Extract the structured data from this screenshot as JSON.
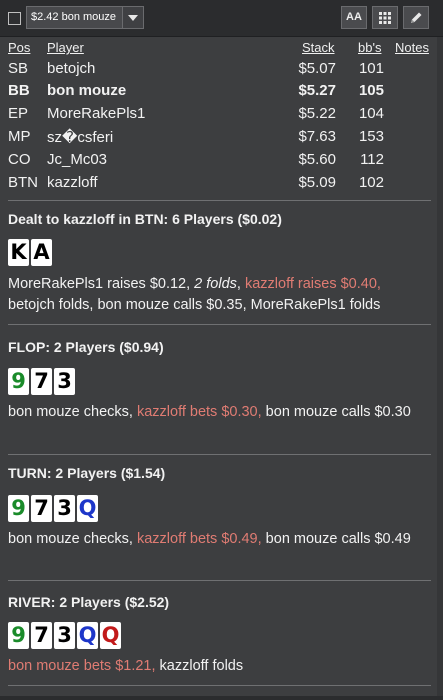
{
  "toolbar": {
    "selected_hand": "$2.42 bon mouze",
    "font_button_label": "AA",
    "grid_icon": "grid-icon",
    "edit_icon": "pencil-icon"
  },
  "table": {
    "headers": {
      "pos": "Pos",
      "player": "Player",
      "stack": "Stack",
      "bbs": "bb's",
      "notes": "Notes"
    },
    "rows": [
      {
        "pos": "SB",
        "player": "betojch",
        "stack": "$5.07",
        "bbs": "101"
      },
      {
        "pos": "BB",
        "player": "bon mouze",
        "stack": "$5.27",
        "bbs": "105",
        "hero": true
      },
      {
        "pos": "EP",
        "player": "MoreRakePls1",
        "stack": "$5.22",
        "bbs": "104"
      },
      {
        "pos": "MP",
        "player": "sz�csferi",
        "stack": "$7.63",
        "bbs": "153"
      },
      {
        "pos": "CO",
        "player": "Jc_Mc03",
        "stack": "$5.60",
        "bbs": "112"
      },
      {
        "pos": "BTN",
        "player": "kazzloff",
        "stack": "$5.09",
        "bbs": "102"
      }
    ]
  },
  "preflop": {
    "title": "Dealt to kazzloff in BTN: 6 Players ($0.02)",
    "cards": [
      {
        "rank": "K",
        "color": "black"
      },
      {
        "rank": "A",
        "color": "black"
      }
    ],
    "a1": "MoreRakePls1 raises $0.12, ",
    "a2": "2 folds",
    "a3": ", ",
    "a4": "kazzloff raises $0.40,",
    "a5": " betojch folds, bon mouze calls $0.35, MoreRakePls1 folds"
  },
  "flop": {
    "title": "FLOP: 2 Players ($0.94)",
    "cards": [
      {
        "rank": "9",
        "color": "green"
      },
      {
        "rank": "7",
        "color": "black"
      },
      {
        "rank": "3",
        "color": "black"
      }
    ],
    "a1": "bon mouze checks, ",
    "a2": "kazzloff bets $0.30,",
    "a3": " bon mouze calls $0.30"
  },
  "turn": {
    "title": "TURN: 2 Players ($1.54)",
    "cards": [
      {
        "rank": "9",
        "color": "green"
      },
      {
        "rank": "7",
        "color": "black"
      },
      {
        "rank": "3",
        "color": "black"
      },
      {
        "rank": "Q",
        "color": "blue"
      }
    ],
    "a1": "bon mouze checks, ",
    "a2": "kazzloff bets $0.49,",
    "a3": " bon mouze calls $0.49"
  },
  "river": {
    "title": "RIVER: 2 Players ($2.52)",
    "cards": [
      {
        "rank": "9",
        "color": "green"
      },
      {
        "rank": "7",
        "color": "black"
      },
      {
        "rank": "3",
        "color": "black"
      },
      {
        "rank": "Q",
        "color": "blue"
      },
      {
        "rank": "Q",
        "color": "red"
      }
    ],
    "a1": "bon mouze bets $1.21,",
    "a2": " kazzloff folds"
  },
  "colors": {
    "background": "#3d3e40",
    "highlight": "#e07c73",
    "suit_green": "#1a8b2a",
    "suit_blue": "#1d36c9",
    "suit_red": "#c21a1a"
  }
}
